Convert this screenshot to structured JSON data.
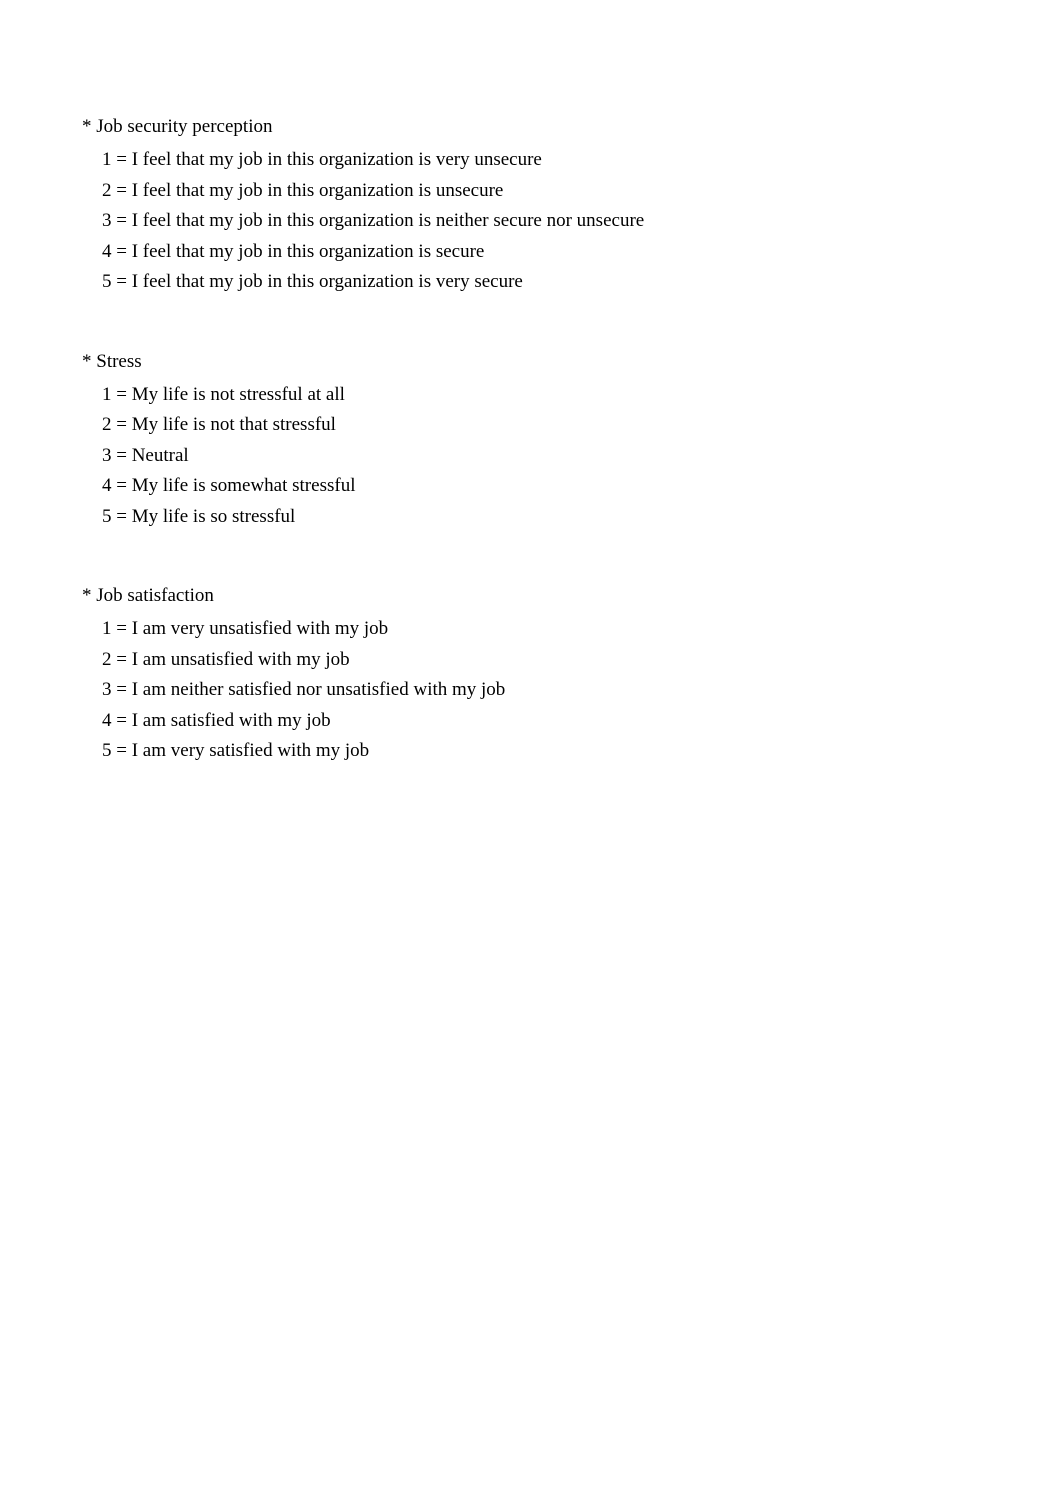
{
  "sections": [
    {
      "title": "* Job security perception",
      "items": [
        "1 = I feel that my job in this organization is very unsecure",
        "2 = I feel that my job in this organization is unsecure",
        "3 = I feel that my job in this organization is neither secure nor unsecure",
        "4 = I feel that my job in this organization is secure",
        "5 = I feel that my job in this organization is very secure"
      ]
    },
    {
      "title": "* Stress",
      "items": [
        "1 = My life is not stressful at all",
        "2 = My life is not that stressful",
        "3 = Neutral",
        "4 = My life is somewhat stressful",
        "5 = My life is so stressful"
      ]
    },
    {
      "title": "* Job satisfaction",
      "items": [
        "1 = I am very unsatisfied with my job",
        "2 = I am unsatisfied with my job",
        "3 = I am neither satisfied nor unsatisfied with my job",
        "4 = I am satisfied with my job",
        "5 = I am very satisfied with my job"
      ]
    }
  ]
}
